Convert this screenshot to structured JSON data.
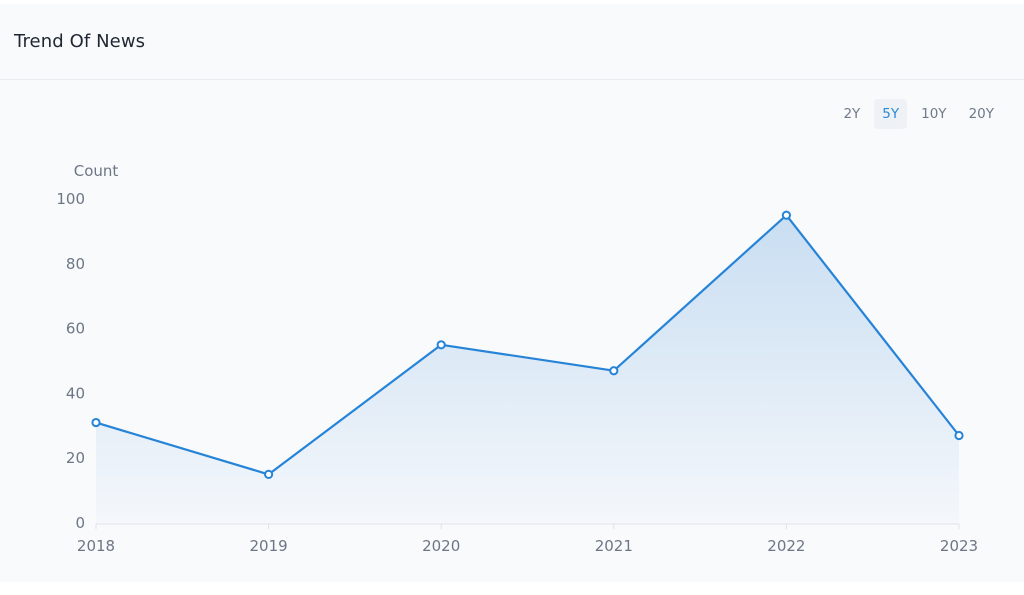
{
  "header": {
    "title": "Trend Of News"
  },
  "range_tabs": [
    {
      "label": "2Y",
      "active": false
    },
    {
      "label": "5Y",
      "active": true
    },
    {
      "label": "10Y",
      "active": false
    },
    {
      "label": "20Y",
      "active": false
    }
  ],
  "colors": {
    "line": "#2684d8",
    "area_top": "#c9def2",
    "area_bottom": "#f4f7fb",
    "active_tab": "#2b8ad8"
  },
  "chart_data": {
    "type": "area",
    "title": "Trend Of News",
    "xlabel": "",
    "ylabel": "Count",
    "categories": [
      "2018",
      "2019",
      "2020",
      "2021",
      "2022",
      "2023"
    ],
    "series": [
      {
        "name": "Count",
        "values": [
          31,
          15,
          55,
          47,
          95,
          27
        ]
      }
    ],
    "ylim": [
      0,
      100
    ],
    "yticks": [
      0,
      20,
      40,
      60,
      80,
      100
    ],
    "grid": false,
    "legend": "none"
  }
}
